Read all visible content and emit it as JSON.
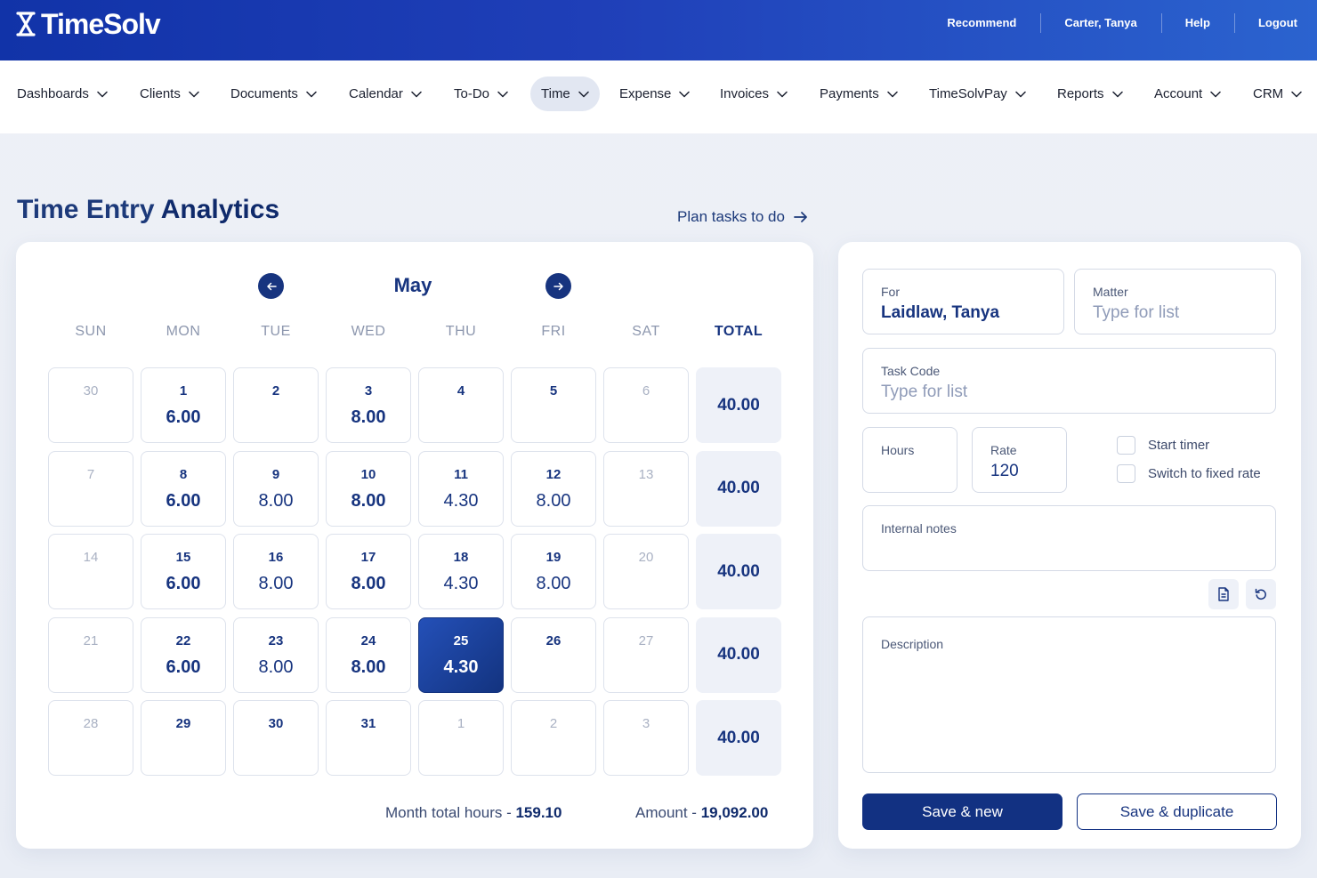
{
  "app": {
    "logo_text": "TimeSolv",
    "top_links": [
      "Recommend",
      "Carter, Tanya",
      "Help",
      "Logout"
    ]
  },
  "nav": {
    "items": [
      "Dashboards",
      "Clients",
      "Documents",
      "Calendar",
      "To-Do",
      "Time",
      "Expense",
      "Invoices",
      "Payments",
      "TimeSolvPay",
      "Reports",
      "Account",
      "CRM"
    ],
    "active": "Time"
  },
  "page": {
    "title_light": "Time Entry",
    "title_bold": "Analytics",
    "plan_link": "Plan tasks to do"
  },
  "calendar": {
    "month": "May",
    "weekdays": [
      "SUN",
      "MON",
      "TUE",
      "WED",
      "THU",
      "FRI",
      "SAT"
    ],
    "total_label": "TOTAL",
    "weeks": [
      {
        "days": [
          {
            "n": "30",
            "h": "",
            "muted": true
          },
          {
            "n": "1",
            "h": "6.00"
          },
          {
            "n": "2",
            "h": ""
          },
          {
            "n": "3",
            "h": "8.00"
          },
          {
            "n": "4",
            "h": ""
          },
          {
            "n": "5",
            "h": ""
          },
          {
            "n": "6",
            "h": "",
            "muted": true
          }
        ],
        "total": "40.00"
      },
      {
        "days": [
          {
            "n": "7",
            "h": "",
            "muted": true
          },
          {
            "n": "8",
            "h": "6.00"
          },
          {
            "n": "9",
            "h": "8.00"
          },
          {
            "n": "10",
            "h": "8.00"
          },
          {
            "n": "11",
            "h": "4.30"
          },
          {
            "n": "12",
            "h": "8.00"
          },
          {
            "n": "13",
            "h": "",
            "muted": true
          }
        ],
        "total": "40.00"
      },
      {
        "days": [
          {
            "n": "14",
            "h": "",
            "muted": true
          },
          {
            "n": "15",
            "h": "6.00"
          },
          {
            "n": "16",
            "h": "8.00"
          },
          {
            "n": "17",
            "h": "8.00"
          },
          {
            "n": "18",
            "h": "4.30"
          },
          {
            "n": "19",
            "h": "8.00"
          },
          {
            "n": "20",
            "h": "",
            "muted": true
          }
        ],
        "total": "40.00"
      },
      {
        "days": [
          {
            "n": "21",
            "h": "",
            "muted": true
          },
          {
            "n": "22",
            "h": "6.00"
          },
          {
            "n": "23",
            "h": "8.00"
          },
          {
            "n": "24",
            "h": "8.00"
          },
          {
            "n": "25",
            "h": "4.30",
            "selected": true
          },
          {
            "n": "26",
            "h": ""
          },
          {
            "n": "27",
            "h": "",
            "muted": true
          }
        ],
        "total": "40.00"
      },
      {
        "days": [
          {
            "n": "28",
            "h": "",
            "muted": true
          },
          {
            "n": "29",
            "h": ""
          },
          {
            "n": "30",
            "h": ""
          },
          {
            "n": "31",
            "h": ""
          },
          {
            "n": "1",
            "h": "",
            "muted": true
          },
          {
            "n": "2",
            "h": "",
            "muted": true
          },
          {
            "n": "3",
            "h": "",
            "muted": true
          }
        ],
        "total": "40.00"
      }
    ],
    "month_total_label": "Month total hours - ",
    "month_total_value": "159.10",
    "amount_label": "Amount - ",
    "amount_value": "19,092.00"
  },
  "form": {
    "for_label": "For",
    "for_value": "Laidlaw, Tanya",
    "matter_label": "Matter",
    "matter_placeholder": "Type for list",
    "task_code_label": "Task Code",
    "task_code_placeholder": "Type for list",
    "hours_label": "Hours",
    "hours_value": "",
    "rate_label": "Rate",
    "rate_value": "120",
    "start_timer_label": "Start timer",
    "fixed_rate_label": "Switch to fixed rate",
    "internal_notes_label": "Internal notes",
    "description_label": "Description",
    "save_new_label": "Save & new",
    "save_duplicate_label": "Save & duplicate"
  },
  "colors": {
    "brand": "#123182",
    "topbar_start": "#1133a8",
    "topbar_end": "#2b63cf",
    "selected_day": "#13337f",
    "total_bg": "#eef1f8"
  },
  "icons": {
    "prev_month": "arrow-left-icon",
    "next_month": "arrow-right-icon",
    "plan_link": "arrow-right-icon",
    "template": "document-icon",
    "reset": "refresh-icon",
    "nav_dropdown": "chevron-down-icon"
  }
}
